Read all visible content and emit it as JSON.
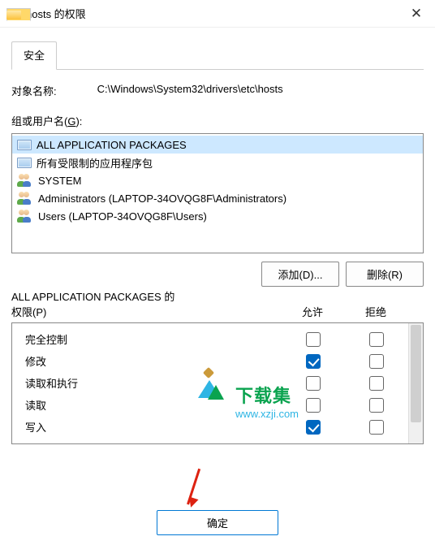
{
  "window": {
    "title": "hosts 的权限"
  },
  "tabs": {
    "security": "安全"
  },
  "object": {
    "label": "对象名称:",
    "value": "C:\\Windows\\System32\\drivers\\etc\\hosts"
  },
  "groups": {
    "label_pre": "组或用户名(",
    "label_hot": "G",
    "label_post": "):",
    "items": [
      {
        "name": "ALL APPLICATION PACKAGES",
        "icon": "screen",
        "selected": true
      },
      {
        "name": "所有受限制的应用程序包",
        "icon": "screen",
        "selected": false
      },
      {
        "name": "SYSTEM",
        "icon": "users",
        "selected": false
      },
      {
        "name": "Administrators (LAPTOP-34OVQG8F\\Administrators)",
        "icon": "users",
        "selected": false
      },
      {
        "name": "Users (LAPTOP-34OVQG8F\\Users)",
        "icon": "users",
        "selected": false
      }
    ]
  },
  "buttons": {
    "add": "添加(D)...",
    "remove": "删除(R)"
  },
  "perm": {
    "title_pre": "ALL APPLICATION PACKAGES 的\n权限(",
    "title_hot": "P",
    "title_post": ")",
    "allow": "允许",
    "deny": "拒绝",
    "rows": [
      {
        "name": "完全控制",
        "allow": false,
        "deny": false
      },
      {
        "name": "修改",
        "allow": true,
        "deny": false
      },
      {
        "name": "读取和执行",
        "allow": false,
        "deny": false
      },
      {
        "name": "读取",
        "allow": false,
        "deny": false
      },
      {
        "name": "写入",
        "allow": true,
        "deny": false
      }
    ]
  },
  "ok": "确定",
  "watermark": {
    "text": "下载集",
    "url": "www.xzji.com"
  }
}
